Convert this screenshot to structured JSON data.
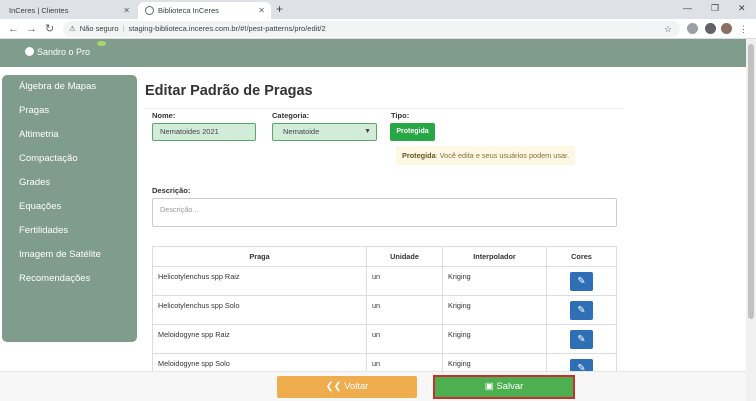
{
  "browser": {
    "tabs": [
      {
        "label": "InCeres | Clientes"
      },
      {
        "label": "Biblioteca InCeres"
      }
    ],
    "url_security": "Não seguro",
    "url": "staging-biblioteca.inceres.com.br/#!/pest-patterns/pro/edit/2"
  },
  "header": {
    "user": "Sandro o Pro"
  },
  "sidebar": {
    "items": [
      {
        "label": "Álgebra de Mapas"
      },
      {
        "label": "Pragas"
      },
      {
        "label": "Altimetria"
      },
      {
        "label": "Compactação"
      },
      {
        "label": "Grades"
      },
      {
        "label": "Equações"
      },
      {
        "label": "Fertilidades"
      },
      {
        "label": "Imagem de Satélite"
      },
      {
        "label": "Recomendações"
      }
    ]
  },
  "main": {
    "title": "Editar Padrão de Pragas",
    "name_label": "Nome:",
    "name_value": "Nematoides 2021",
    "category_label": "Categoria:",
    "category_value": "Nematoide",
    "type_label": "Tipo:",
    "type_badge": "Protegida",
    "hint_strong": "Protegida",
    "hint_text": ": Você edita e seus usuários podem usar.",
    "desc_label": "Descrição:",
    "desc_placeholder": "Descrição..."
  },
  "table": {
    "headers": [
      "Praga",
      "Unidade",
      "Interpolador",
      "Cores"
    ],
    "rows": [
      {
        "praga": "Helicotylenchus spp Raiz",
        "unidade": "un",
        "interpolador": "Kriging"
      },
      {
        "praga": "Helicotylenchus spp Solo",
        "unidade": "un",
        "interpolador": "Kriging"
      },
      {
        "praga": "Meloidogyne spp Raiz",
        "unidade": "un",
        "interpolador": "Kriging"
      },
      {
        "praga": "Meloidogyne spp Solo",
        "unidade": "un",
        "interpolador": "Kriging"
      }
    ]
  },
  "footer": {
    "back_label": "Voltar",
    "save_label": "Salvar"
  },
  "icons": {
    "cores_button": "paintbrush-icon",
    "back": "double-chevron-left-icon",
    "save": "floppy-disk-icon"
  }
}
